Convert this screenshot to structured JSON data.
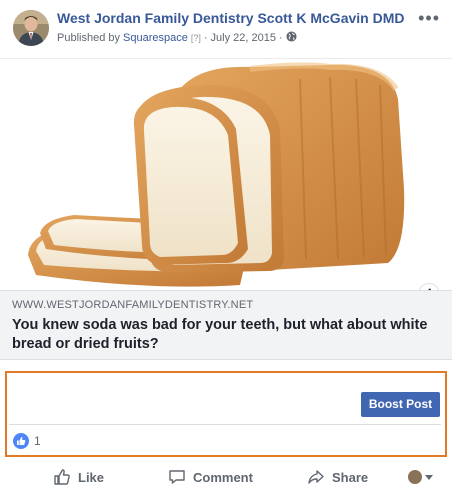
{
  "post": {
    "page_name": "West Jordan Family Dentistry Scott K McGavin DMD",
    "published_by_prefix": "Published by",
    "publisher": "Squarespace",
    "help_marker": "[?]",
    "separator": "·",
    "date": "July 22, 2015",
    "separator2": "·",
    "audience_icon": "globe-icon",
    "more_icon": "more-options-icon"
  },
  "image": {
    "subject": "sliced bread loaf",
    "info_icon": "info-icon"
  },
  "link_preview": {
    "domain": "WWW.WESTJORDANFAMILYDENTISTRY.NET",
    "headline": "You knew soda was bad for your teeth, but what about white bread or dried fruits?"
  },
  "boost": {
    "label": "Boost Post",
    "color": "#4267b2"
  },
  "reactions": {
    "icon": "like-reaction-icon",
    "count": "1"
  },
  "actions": {
    "like": "Like",
    "comment": "Comment",
    "share": "Share"
  },
  "colors": {
    "highlight": "#e07a26",
    "link": "#385898"
  }
}
